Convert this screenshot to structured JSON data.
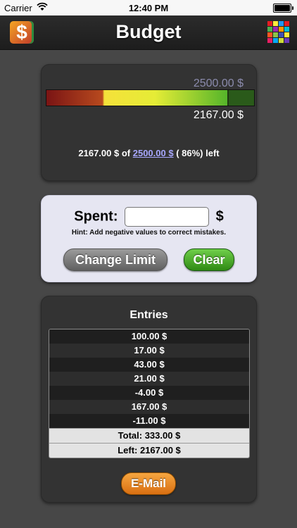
{
  "status_bar": {
    "carrier": "Carrier",
    "time": "12:40 PM"
  },
  "nav": {
    "title": "Budget",
    "app_icon_glyph": "$"
  },
  "budget": {
    "limit": "2500.00 $",
    "remaining": "2167.00 $",
    "progress_fraction": 0.87,
    "summary_remaining": "2167.00 $ of",
    "summary_limit_link": "2500.00 $",
    "summary_percent": "( 86%) left"
  },
  "input": {
    "spent_label": "Spent:",
    "spent_value": "",
    "currency": "$",
    "hint": "Hint: Add negative values to correct mistakes.",
    "change_limit_label": "Change Limit",
    "clear_label": "Clear"
  },
  "entries": {
    "title": "Entries",
    "rows": [
      "100.00 $",
      "17.00 $",
      "43.00 $",
      "21.00 $",
      "-4.00 $",
      "167.00 $",
      "-11.00 $"
    ],
    "total": "Total: 333.00 $",
    "left": "Left: 2167.00 $",
    "email_label": "E-Mail"
  },
  "colors": {
    "background": "#474747",
    "panel_dark": "#333333",
    "panel_light": "#e6e6f2",
    "button_green": "#3fa11e",
    "button_orange": "#e8862a"
  },
  "color_grid": [
    "#e51c23",
    "#ffeb3b",
    "#2196f3",
    "#e51c23",
    "#4caf50",
    "#9c27b0",
    "#ff9800",
    "#00bcd4",
    "#ff5722",
    "#8bc34a",
    "#3f51b5",
    "#ffeb3b",
    "#e91e63",
    "#03a9f4",
    "#cddc39",
    "#673ab7"
  ]
}
